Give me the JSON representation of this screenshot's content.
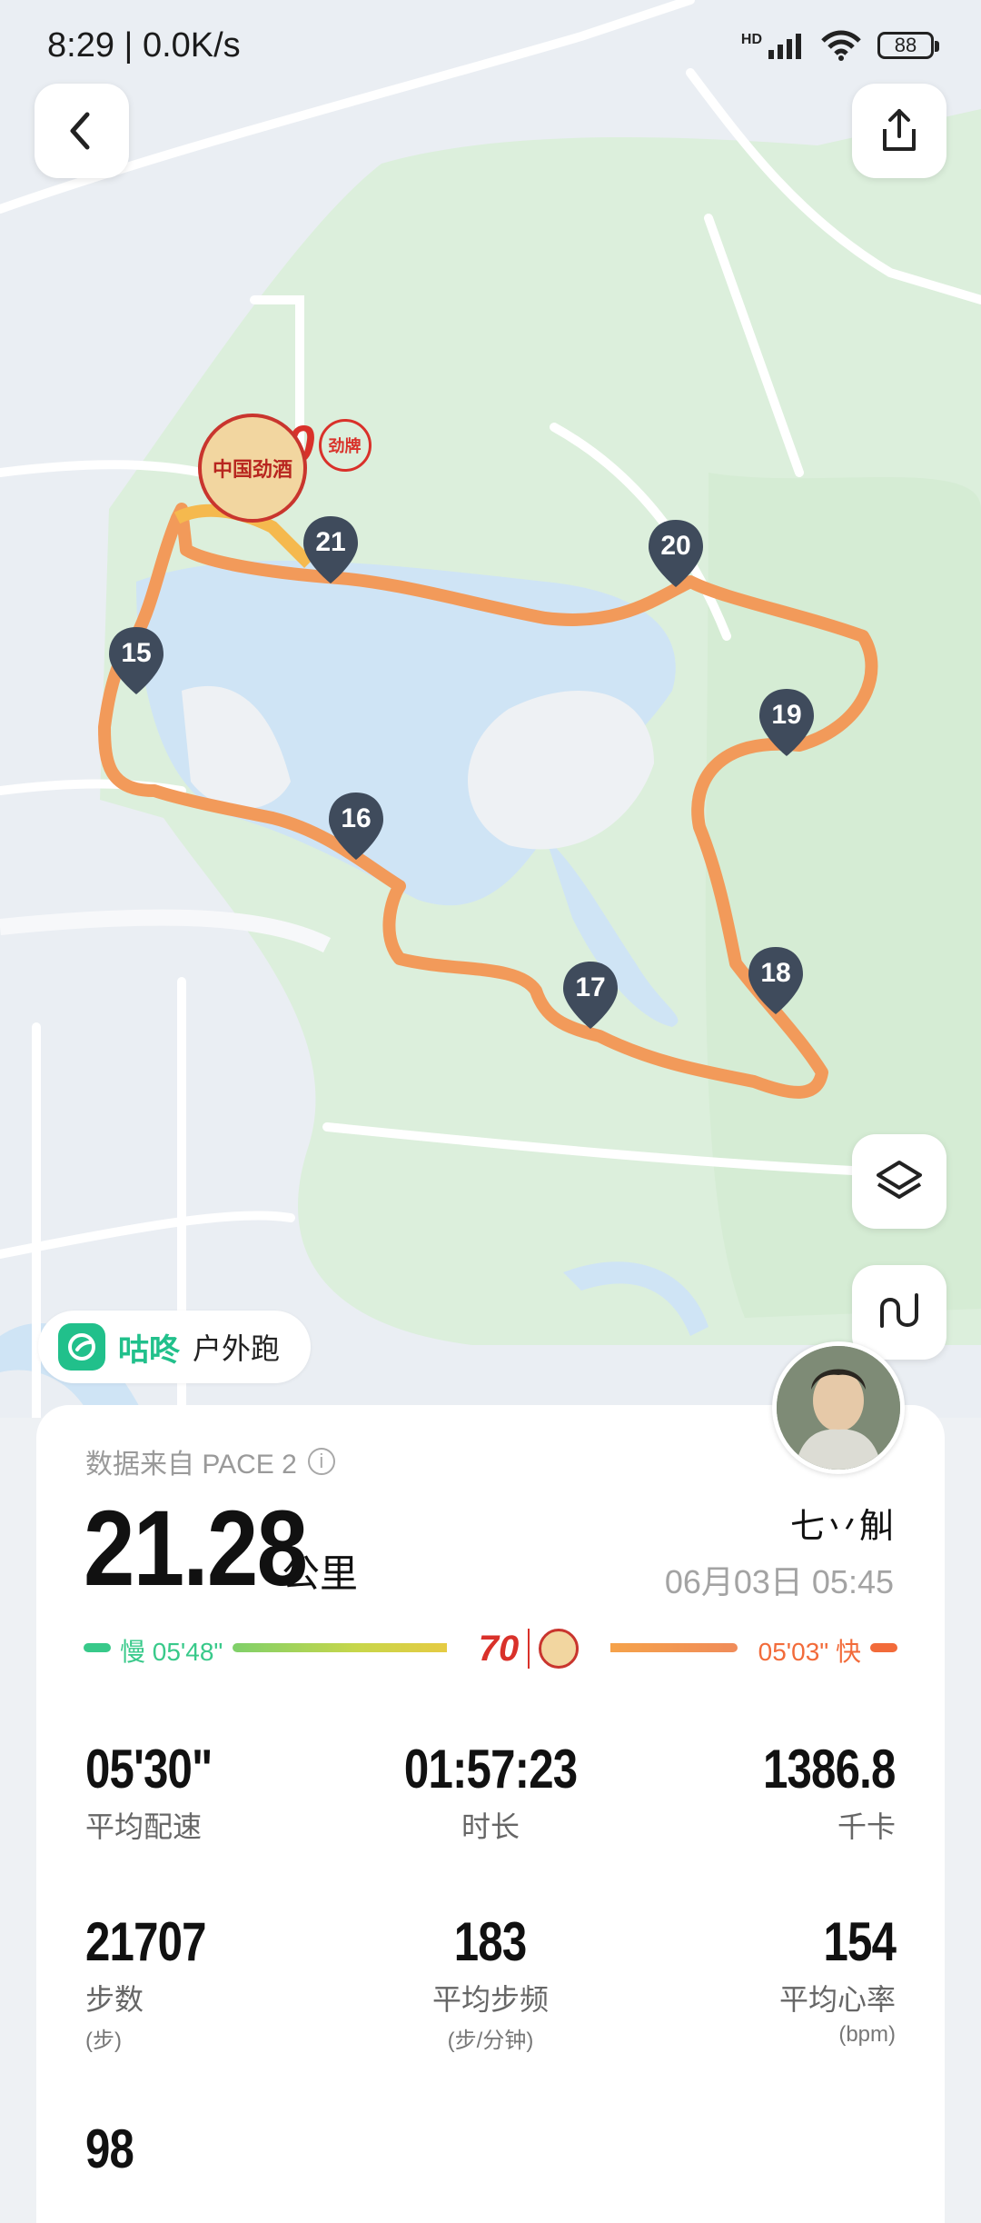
{
  "status_bar": {
    "time": "8:29 | 0.0K/s",
    "network_badge": "HD",
    "battery": "88"
  },
  "map": {
    "km_markers": [
      "15",
      "16",
      "17",
      "18",
      "19",
      "20",
      "21"
    ],
    "route_colors": {
      "main": "#f2955a",
      "highlight": "#f5b94e"
    },
    "sponsor_badge": {
      "top": "70",
      "top_side": "劲牌",
      "main": "中国劲酒"
    }
  },
  "header": {
    "back_icon": "chevron-left-icon",
    "share_icon": "share-icon",
    "layers_icon": "layers-icon",
    "route_icon": "route-icon"
  },
  "brand": {
    "name": "咕咚",
    "activity": "户外跑",
    "color": "#21c08b"
  },
  "summary": {
    "source_text": "数据来自 PACE 2",
    "distance": "21.28",
    "distance_unit": "公里",
    "username": "七丷觓",
    "datetime": "06月03日 05:45",
    "pace_slow_label": "慢 05'48\"",
    "pace_fast_label": "05'03\" 快",
    "pace_badge_small": "70"
  },
  "stats": [
    {
      "value": "05'30\"",
      "label": "平均配速",
      "unit": ""
    },
    {
      "value": "01:57:23",
      "label": "时长",
      "unit": ""
    },
    {
      "value": "1386.8",
      "label": "千卡",
      "unit": ""
    },
    {
      "value": "21707",
      "label": "步数",
      "unit": "(步)"
    },
    {
      "value": "183",
      "label": "平均步频",
      "unit": "(步/分钟)"
    },
    {
      "value": "154",
      "label": "平均心率",
      "unit": "(bpm)"
    },
    {
      "value": "98",
      "label": "",
      "unit": ""
    }
  ]
}
